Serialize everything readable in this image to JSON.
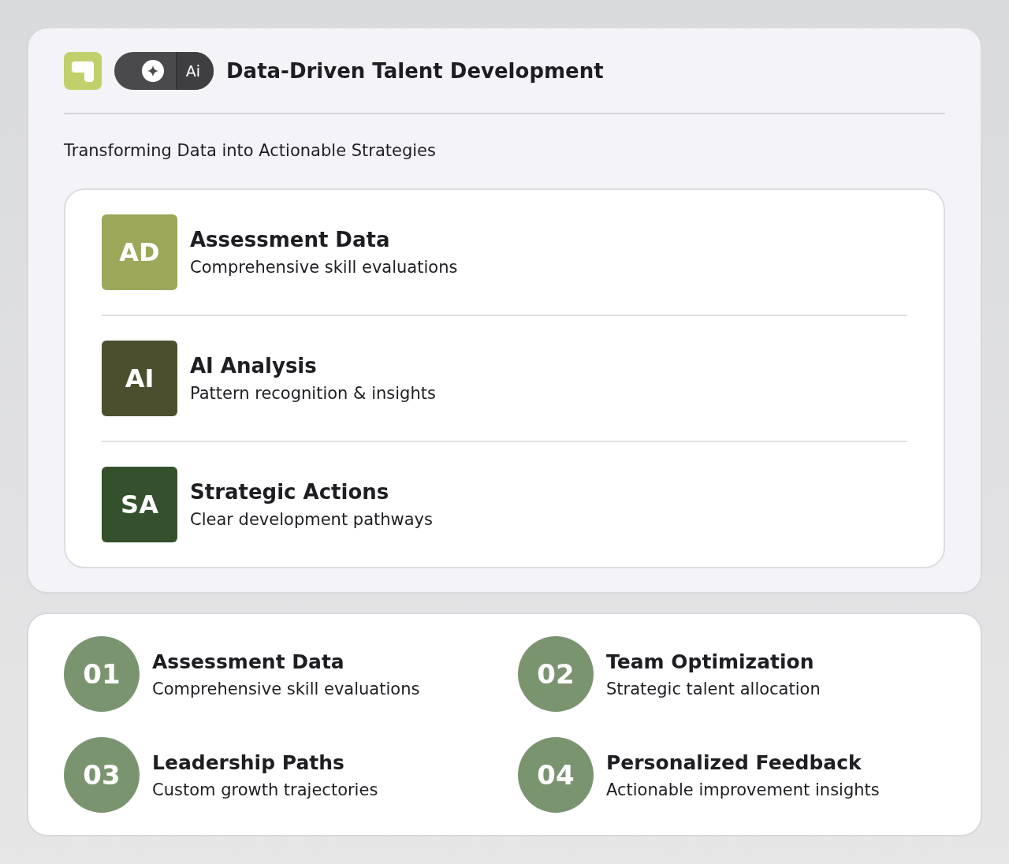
{
  "header": {
    "toggle_label": "Ai",
    "title": "Data-Driven Talent Development"
  },
  "subtitle": "Transforming Data into Actionable Strategies",
  "pipeline": [
    {
      "badge": "AD",
      "color": "#9ca75a",
      "title": "Assessment Data",
      "description": "Comprehensive skill evaluations"
    },
    {
      "badge": "AI",
      "color": "#4c4f2e",
      "title": "AI Analysis",
      "description": "Pattern recognition & insights"
    },
    {
      "badge": "SA",
      "color": "#34502c",
      "title": "Strategic Actions",
      "description": "Clear development pathways"
    }
  ],
  "features": [
    {
      "number": "01",
      "title": "Assessment Data",
      "description": "Comprehensive skill evaluations"
    },
    {
      "number": "02",
      "title": "Team Optimization",
      "description": "Strategic talent allocation"
    },
    {
      "number": "03",
      "title": "Leadership Paths",
      "description": "Custom growth trajectories"
    },
    {
      "number": "04",
      "title": "Personalized Feedback",
      "description": "Actionable improvement insights"
    }
  ]
}
